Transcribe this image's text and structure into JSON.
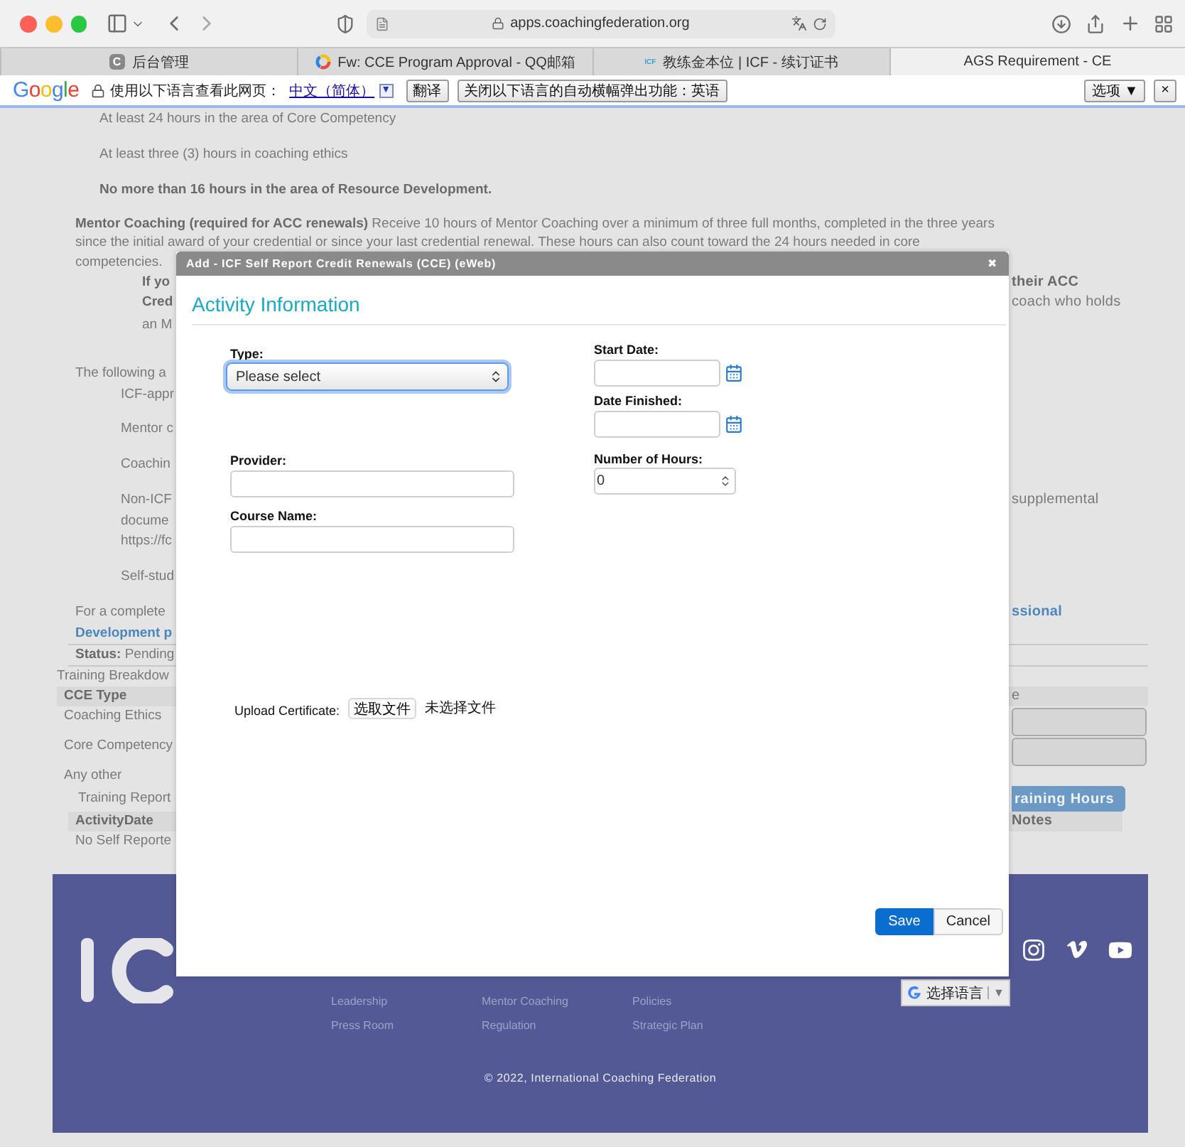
{
  "browser": {
    "url": "apps.coachingfederation.org",
    "tabs": [
      {
        "label": "后台管理",
        "selected": false,
        "kind": "letter",
        "icon_text": "C"
      },
      {
        "label": "Fw: CCE Program Approval - QQ邮箱",
        "selected": false,
        "kind": "ring"
      },
      {
        "label": "教练金本位 | ICF - 续订证书",
        "selected": false,
        "kind": "wordmark",
        "icon_text": "ICF"
      },
      {
        "label": "AGS Requirement - CE",
        "selected": true,
        "kind": "plain"
      }
    ]
  },
  "translate_bar": {
    "brand": "Google",
    "prompt": "使用以下语言查看此网页：",
    "language": "中文（简体）",
    "language_menu": "▼",
    "translate_button": "翻译",
    "never_button": "关闭以下语言的自动横幅弹出功能：英语",
    "options_button": "选项 ▼",
    "close": "×"
  },
  "page_rows": [
    {
      "kind": "req",
      "left": {
        "text": "At least 24 hours in the area of Core Competency"
      }
    },
    {
      "kind": "req",
      "left": {
        "text": "At least three (3) hours in coaching ethics"
      }
    },
    {
      "kind": "req",
      "left": {
        "text": "No more than 16 hours in the area of Resource Development.",
        "kind": "bold"
      }
    },
    {
      "kind": "lead",
      "left": {
        "text": "**Mentor Coaching (required for ACC renewals)** Receive 10 hours of Mentor Coaching over a minimum of three full months, completed in the three years"
      }
    },
    {
      "kind": "lead",
      "left": {
        "text": "since the initial award of your credential or since your last credential renewal. These hours can also count toward the 24 hours needed in core"
      }
    },
    {
      "kind": "para",
      "left": {
        "text": "competencies."
      }
    },
    {
      "kind": "note",
      "left": {
        "text": "If yo",
        "kind": "bold"
      },
      "right": {
        "text": "their ACC",
        "kind": "bold"
      }
    },
    {
      "kind": "note",
      "left": {
        "text": "Cred",
        "kind": "bold"
      },
      "right": {
        "text": "coach who holds"
      }
    },
    {
      "kind": "note",
      "left": {
        "text": "an M"
      }
    },
    {
      "kind": "para",
      "left": {
        "text": "The following a"
      }
    },
    {
      "kind": "item",
      "left": {
        "text": "ICF-appr"
      }
    },
    {
      "kind": "item",
      "left": {
        "text": "Mentor c"
      }
    },
    {
      "kind": "item",
      "left": {
        "text": "Coachin"
      }
    },
    {
      "kind": "item",
      "left": {
        "text": "Non-ICF"
      },
      "right": {
        "text": "supplemental"
      }
    },
    {
      "kind": "item",
      "left": {
        "text": "docume"
      }
    },
    {
      "kind": "item",
      "left": {
        "text": "https://fc"
      }
    },
    {
      "kind": "item",
      "left": {
        "text": "Self-stud"
      }
    },
    {
      "kind": "para",
      "left": {
        "text": "For a complete"
      },
      "right": {
        "text": "ssional",
        "kind": "link"
      }
    },
    {
      "kind": "ruled",
      "left": {
        "text": "Development p",
        "kind": "link"
      }
    },
    {
      "kind": "ruled",
      "left": {
        "text": "**Status:** Pending"
      }
    },
    {
      "kind": "section",
      "left": {
        "text": "Training Breakdow"
      }
    },
    {
      "kind": "head",
      "left": {
        "text": "CCE Type",
        "kind": "bold"
      },
      "right": {
        "text": "e"
      }
    },
    {
      "kind": "cell",
      "left": {
        "text": "Coaching Ethics"
      },
      "right": {
        "kind": "field"
      }
    },
    {
      "kind": "cell",
      "left": {
        "text": "Core Competency"
      },
      "right": {
        "kind": "field"
      }
    },
    {
      "kind": "cell",
      "left": {
        "text": "Any other"
      }
    },
    {
      "kind": "sub",
      "left": {
        "text": "Training Report"
      },
      "right": {
        "text": "raining Hours",
        "kind": "button"
      }
    },
    {
      "kind": "subhead",
      "left": {
        "text": "ActivityDate",
        "kind": "bold"
      },
      "right": {
        "text": "Notes",
        "kind": "bold"
      }
    },
    {
      "kind": "subbody",
      "left": {
        "text": "No Self Reporte"
      }
    }
  ],
  "modal": {
    "title": "Add - ICF Self Report Credit Renewals (CCE) (eWeb)",
    "close": "✖",
    "heading": "Activity Information",
    "left_fields": [
      {
        "label": "Type:",
        "kind": "select",
        "value": "Please select",
        "focused": true
      },
      {
        "label": "Provider:",
        "kind": "text"
      },
      {
        "label": "Course Name:",
        "kind": "text"
      }
    ],
    "right_fields": [
      {
        "label": "Start Date:",
        "kind": "date"
      },
      {
        "label": "Date Finished:",
        "kind": "date"
      },
      {
        "label": "Number of Hours:",
        "kind": "number",
        "value": "0"
      }
    ],
    "upload": {
      "label": "Upload Certificate:",
      "button": "选取文件",
      "status": "未选择文件"
    },
    "buttons": [
      {
        "label": "Save",
        "primary": true
      },
      {
        "label": "Cancel",
        "primary": false
      }
    ]
  },
  "footer": {
    "links": [
      "Leadership",
      "Mentor Coaching",
      "Policies",
      "Press Room",
      "Regulation",
      "Strategic Plan"
    ],
    "social": [
      {
        "kind": "instagram"
      },
      {
        "kind": "vimeo"
      },
      {
        "kind": "youtube"
      }
    ],
    "language_widget": {
      "label": "选择语言",
      "menu": "▼"
    },
    "copyright": "© 2022, International Coaching Federation"
  }
}
